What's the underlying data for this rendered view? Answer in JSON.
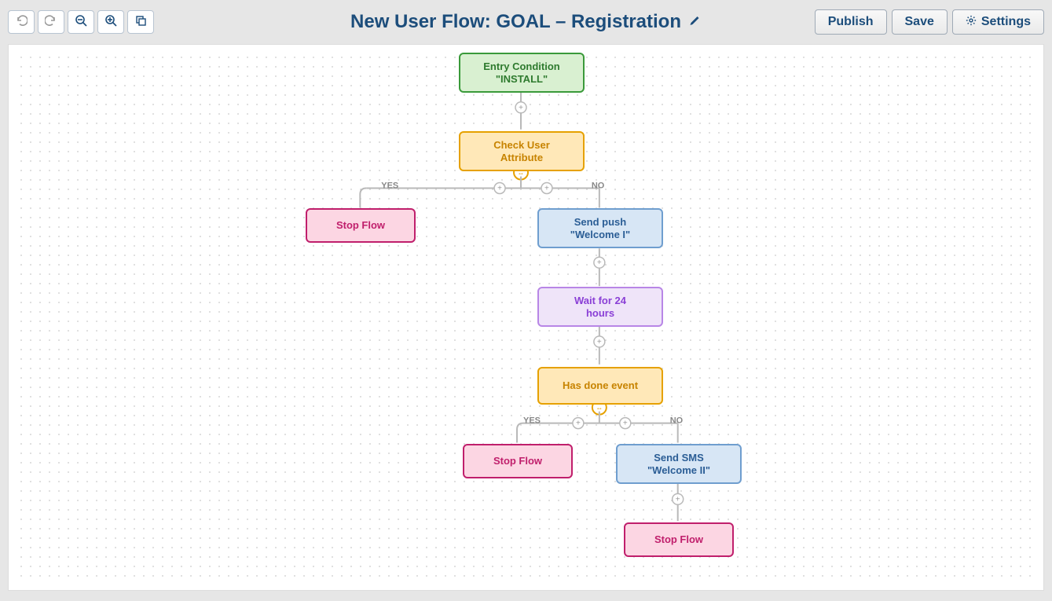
{
  "toolbar": {
    "publish": "Publish",
    "save": "Save",
    "settings": "Settings"
  },
  "title": "New User Flow: GOAL – Registration",
  "labels": {
    "yes": "YES",
    "no": "NO"
  },
  "nodes": {
    "entry": {
      "l1": "Entry Condition",
      "l2": "\"INSTALL\""
    },
    "check": {
      "l1": "Check User",
      "l2": "Attribute"
    },
    "stop1": {
      "l1": "Stop Flow",
      "l2": ""
    },
    "push": {
      "l1": "Send push",
      "l2": "\"Welcome I\""
    },
    "wait": {
      "l1": "Wait for 24",
      "l2": "hours"
    },
    "event": {
      "l1": "Has done event",
      "l2": ""
    },
    "stop2": {
      "l1": "Stop Flow",
      "l2": ""
    },
    "sms": {
      "l1": "Send SMS",
      "l2": "\"Welcome II\""
    },
    "stop3": {
      "l1": "Stop Flow",
      "l2": ""
    }
  }
}
